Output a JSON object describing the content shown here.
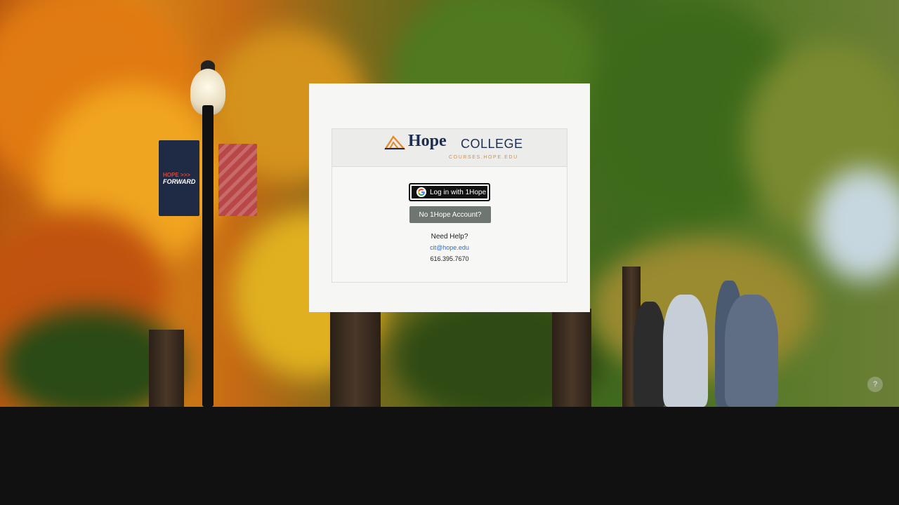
{
  "background": {
    "banner_line1": "HOPE >>>",
    "banner_line2": "FORWARD"
  },
  "logo": {
    "name_main": "Hope",
    "name_secondary": "COLLEGE",
    "subtitle": "COURSES.HOPE.EDU",
    "accent_color": "#e58b2e",
    "brand_color": "#1d2d52"
  },
  "login": {
    "google_button_label": "Log in with 1Hope",
    "no_account_button_label": "No 1Hope Account?"
  },
  "help": {
    "title": "Need Help?",
    "email": "cit@hope.edu",
    "phone": "616.395.7670",
    "floating_help_glyph": "?"
  }
}
